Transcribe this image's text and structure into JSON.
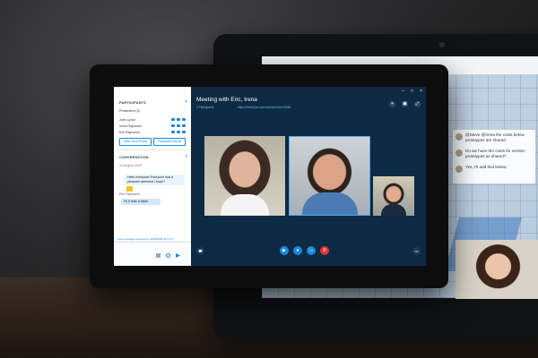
{
  "sidebar": {
    "participants_header": "PARTICIPANTS",
    "participants_count": "Presenters (3)",
    "participants": [
      "John Lynch",
      "Irena Raymond",
      "Eric Raymond"
    ],
    "invite_button": "Invite More People",
    "participant_actions_button": "Participant Actions",
    "conversation_header": "CONVERSATION",
    "date": "24 August 2015",
    "sender": "Eric Raymond",
    "messages": {
      "incoming": "Hello everyone! Everyone had a pleasant weekend I hope?",
      "outgoing": "Hi, it was a blast!"
    },
    "last_message": "Last message received on 24/08/2015 at 10:17."
  },
  "meeting": {
    "title": "Meeting with Eric, Irena",
    "subtitle_status": "2 Participants",
    "subtitle_link": "https://meet.lync.com/contoso/ericr/12345"
  },
  "back_screen": {
    "chat": [
      "@Steve @Irena the costs below prototypes are shared.",
      "Do we have the costs for version prototypes as shared?",
      "Yes, I'll add that below."
    ]
  },
  "colors": {
    "accent": "#1b87d6",
    "meeting_bg": "#0d2a44",
    "end_call": "#e0333d"
  }
}
